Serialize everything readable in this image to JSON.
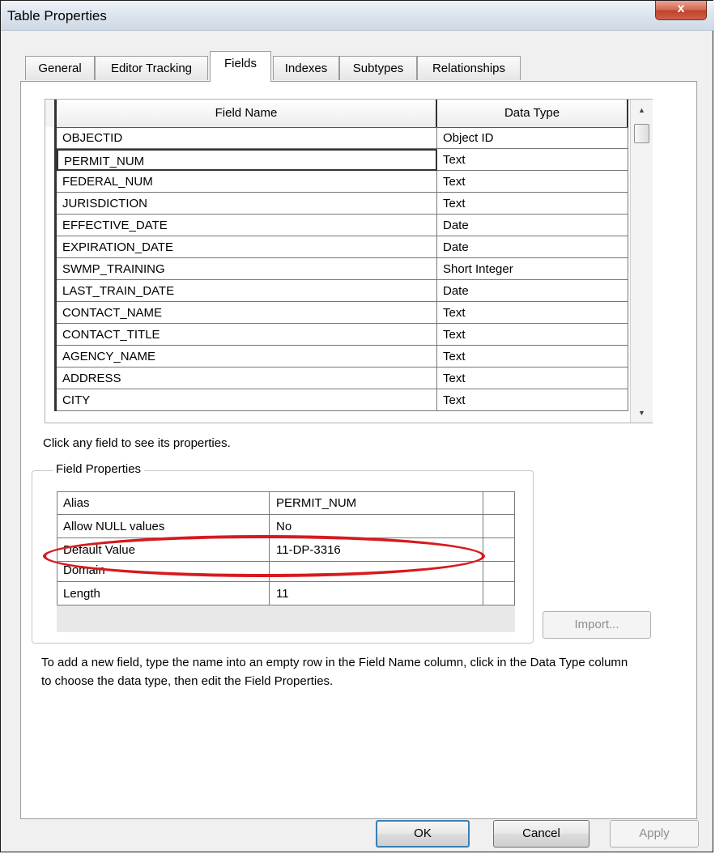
{
  "window": {
    "title": "Table Properties",
    "close_label": "x"
  },
  "tabs": [
    {
      "label": "General",
      "active": false
    },
    {
      "label": "Editor Tracking",
      "active": false
    },
    {
      "label": "Fields",
      "active": true
    },
    {
      "label": "Indexes",
      "active": false
    },
    {
      "label": "Subtypes",
      "active": false
    },
    {
      "label": "Relationships",
      "active": false
    }
  ],
  "fields_grid": {
    "columns": [
      "Field Name",
      "Data Type"
    ],
    "rows": [
      {
        "name": "OBJECTID",
        "type": "Object ID"
      },
      {
        "name": "PERMIT_NUM",
        "type": "Text",
        "editing": true
      },
      {
        "name": "FEDERAL_NUM",
        "type": "Text"
      },
      {
        "name": "JURISDICTION",
        "type": "Text"
      },
      {
        "name": "EFFECTIVE_DATE",
        "type": "Date"
      },
      {
        "name": "EXPIRATION_DATE",
        "type": "Date"
      },
      {
        "name": "SWMP_TRAINING",
        "type": "Short Integer"
      },
      {
        "name": "LAST_TRAIN_DATE",
        "type": "Date"
      },
      {
        "name": "CONTACT_NAME",
        "type": "Text"
      },
      {
        "name": "CONTACT_TITLE",
        "type": "Text"
      },
      {
        "name": "AGENCY_NAME",
        "type": "Text"
      },
      {
        "name": "ADDRESS",
        "type": "Text"
      },
      {
        "name": "CITY",
        "type": "Text"
      }
    ],
    "scroll_up_icon": "scroll-up-arrow",
    "scroll_down_icon": "scroll-down-arrow"
  },
  "hint_text": "Click any field to see its properties.",
  "field_properties": {
    "group_label": "Field Properties",
    "rows": [
      {
        "property": "Alias",
        "value": "PERMIT_NUM"
      },
      {
        "property": "Allow NULL values",
        "value": "No"
      },
      {
        "property": "Default Value",
        "value": "11-DP-3316"
      },
      {
        "property": "Domain",
        "value": ""
      },
      {
        "property": "Length",
        "value": "11"
      }
    ],
    "import_label": "Import..."
  },
  "help_text": "To add a new field, type the name into an empty row in the Field Name column, click in the Data Type column to choose the data type, then edit the Field Properties.",
  "buttons": {
    "ok": "OK",
    "cancel": "Cancel",
    "apply": "Apply"
  },
  "annotation": {
    "shape": "ellipse",
    "color": "#d61a1f",
    "highlights": "Default Value"
  }
}
